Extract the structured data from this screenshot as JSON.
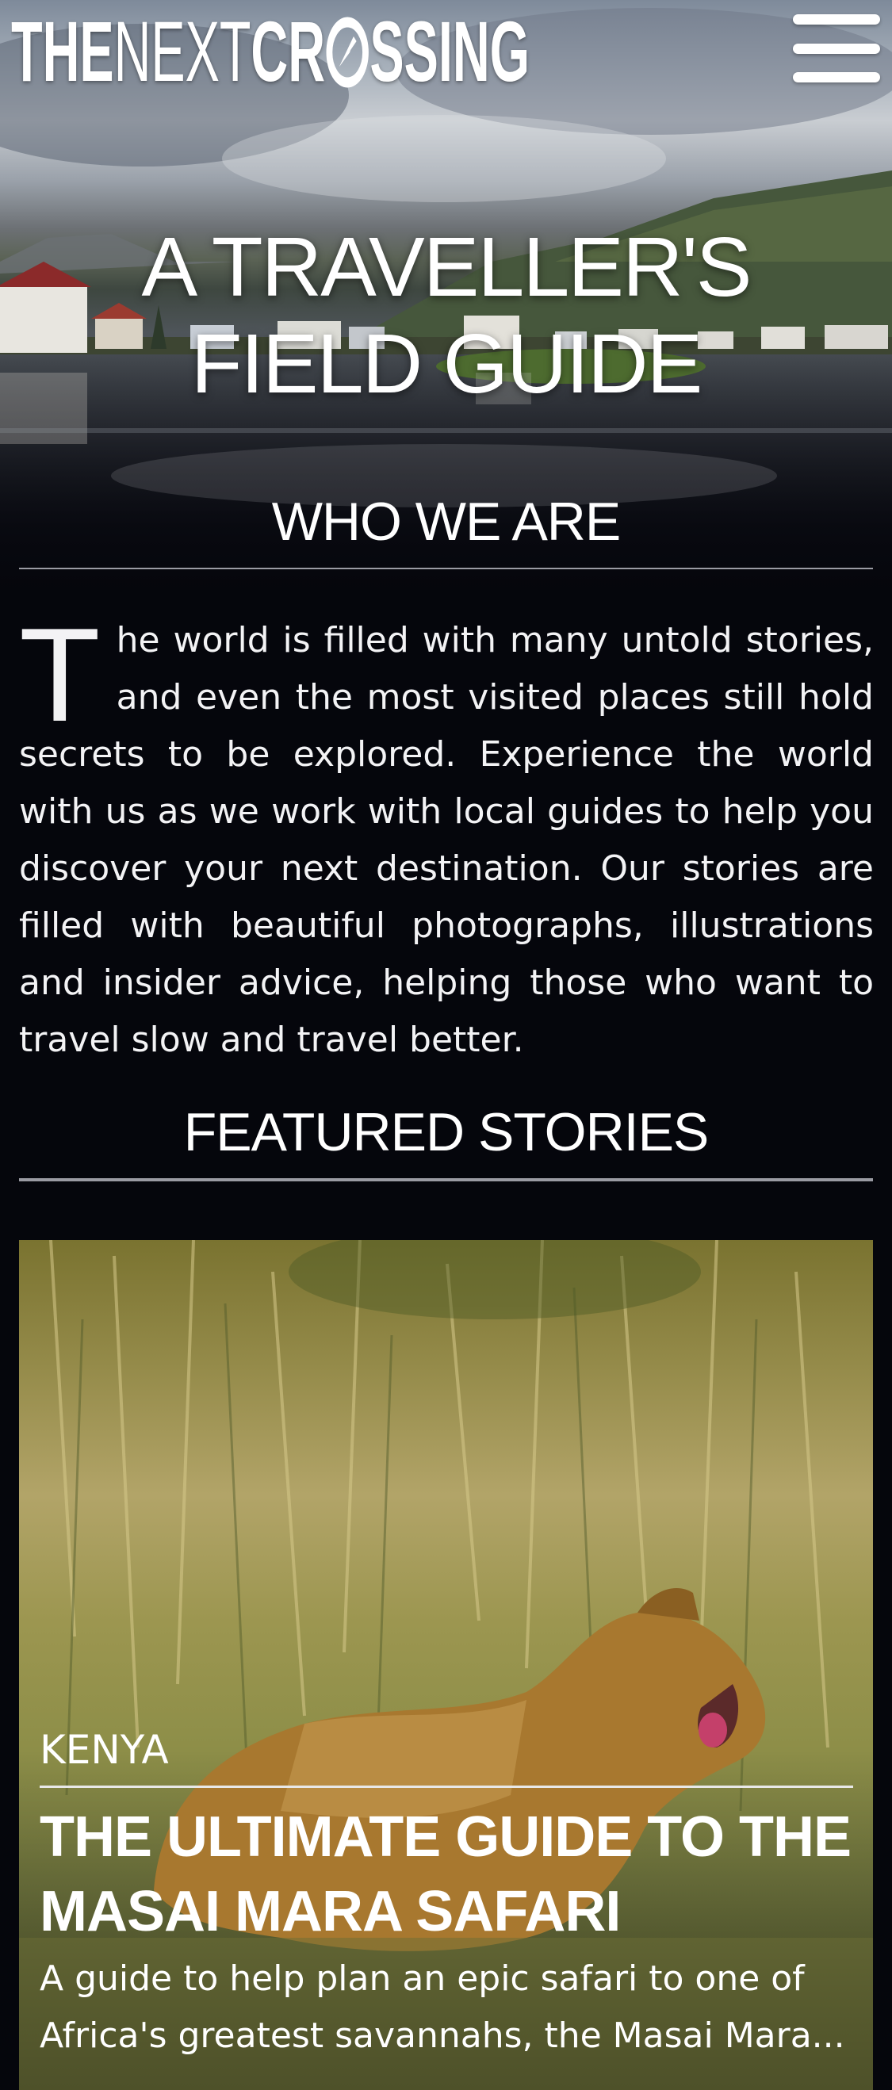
{
  "header": {
    "logo_bold_1": "THE",
    "logo_light": "NEXT",
    "logo_bold_2": "CR",
    "logo_bold_3": "SSING",
    "menu_icon": "hamburger-menu-icon"
  },
  "hero": {
    "title": "A TRAVELLER'S FIELD GUIDE"
  },
  "about": {
    "heading": "WHO WE ARE",
    "dropcap": "T",
    "text": "he world is filled with many untold stories, and even the most visited places still hold secrets to be explored. Experience the world with us as we work with local guides to help you discover your next destination. Our stories are filled with beautiful photographs, illustrations and insider advice, helping those who want to travel slow and travel better."
  },
  "featured": {
    "heading": "FEATURED STORIES",
    "stories": [
      {
        "country": "KENYA",
        "title": "THE ULTIMATE GUIDE TO THE MASAI MARA SAFARI",
        "description": "A guide to help plan an epic safari to one of Africa's greatest savannahs, the Masai Mara..."
      }
    ]
  },
  "colors": {
    "background": "#05060c",
    "text": "#ffffff",
    "rule": "#9a9ba3"
  }
}
